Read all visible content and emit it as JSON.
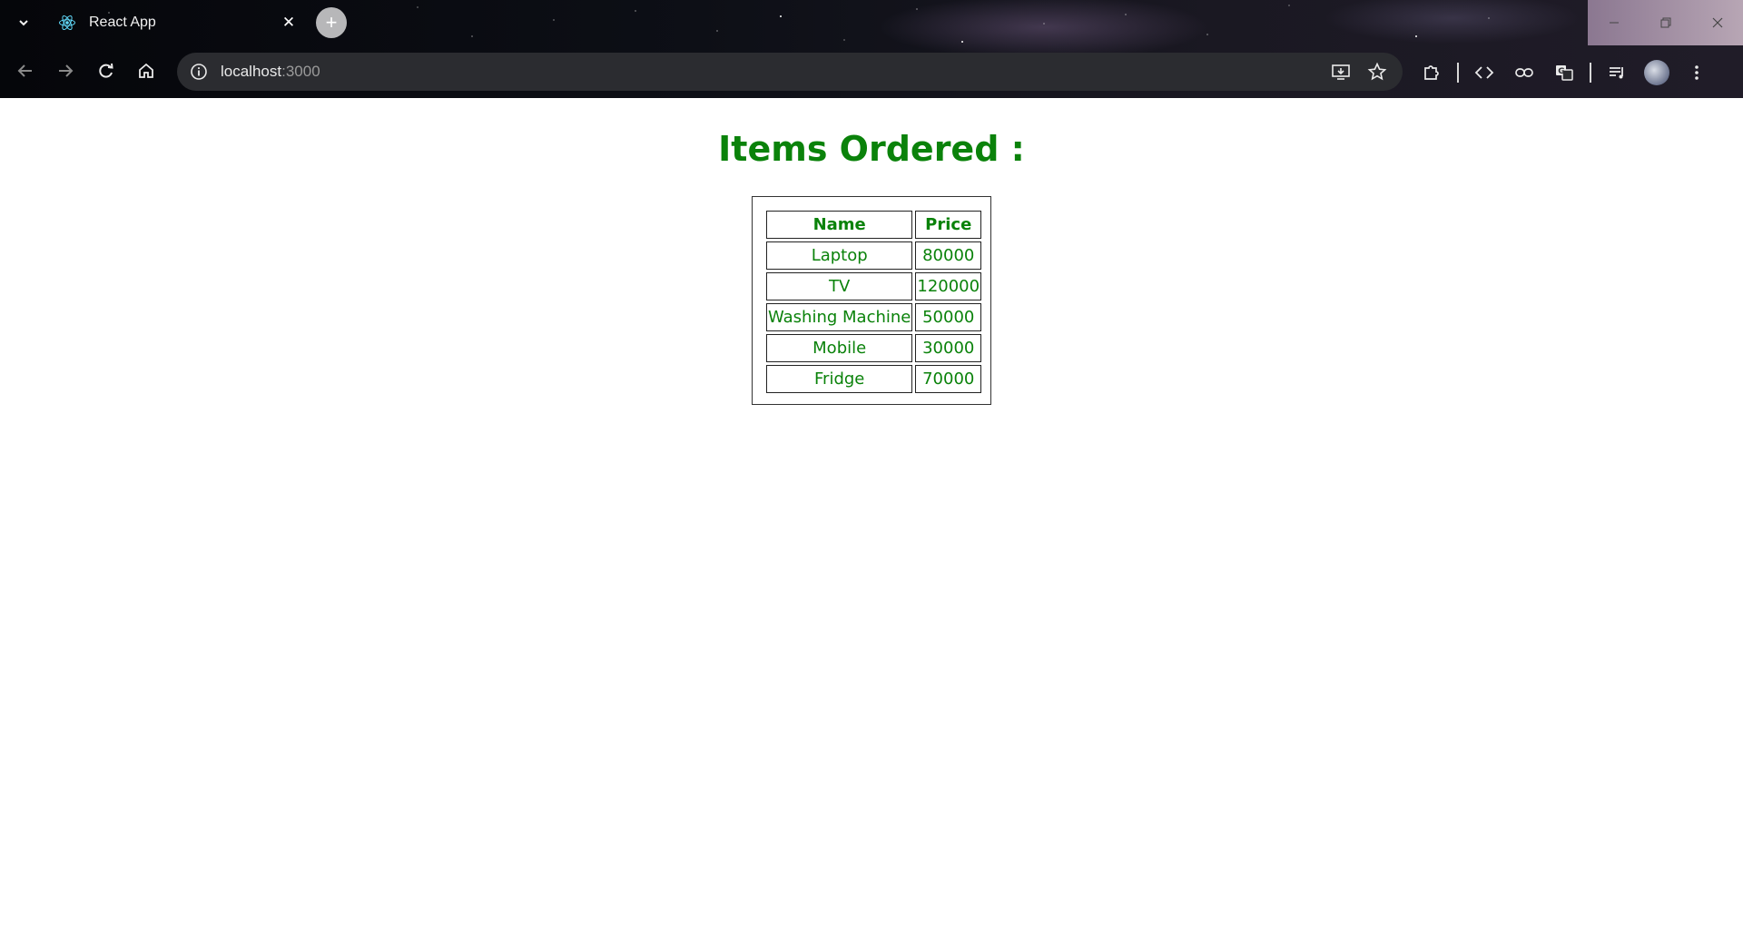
{
  "browser": {
    "tab": {
      "title": "React App",
      "favicon": "react-icon"
    },
    "address_bar": {
      "host": "localhost",
      "port": ":3000"
    },
    "window_controls": [
      "minimize",
      "restore",
      "close"
    ]
  },
  "page": {
    "title": "Items Ordered :",
    "table": {
      "headers": [
        "Name",
        "Price"
      ],
      "rows": [
        {
          "name": "Laptop",
          "price": "80000"
        },
        {
          "name": "TV",
          "price": "120000"
        },
        {
          "name": "Washing Machine",
          "price": "50000"
        },
        {
          "name": "Mobile",
          "price": "30000"
        },
        {
          "name": "Fridge",
          "price": "70000"
        }
      ]
    }
  },
  "colors": {
    "accent_green": "#0a820a",
    "toolbar_bg": "#2b2c30",
    "page_bg": "#ffffff"
  }
}
